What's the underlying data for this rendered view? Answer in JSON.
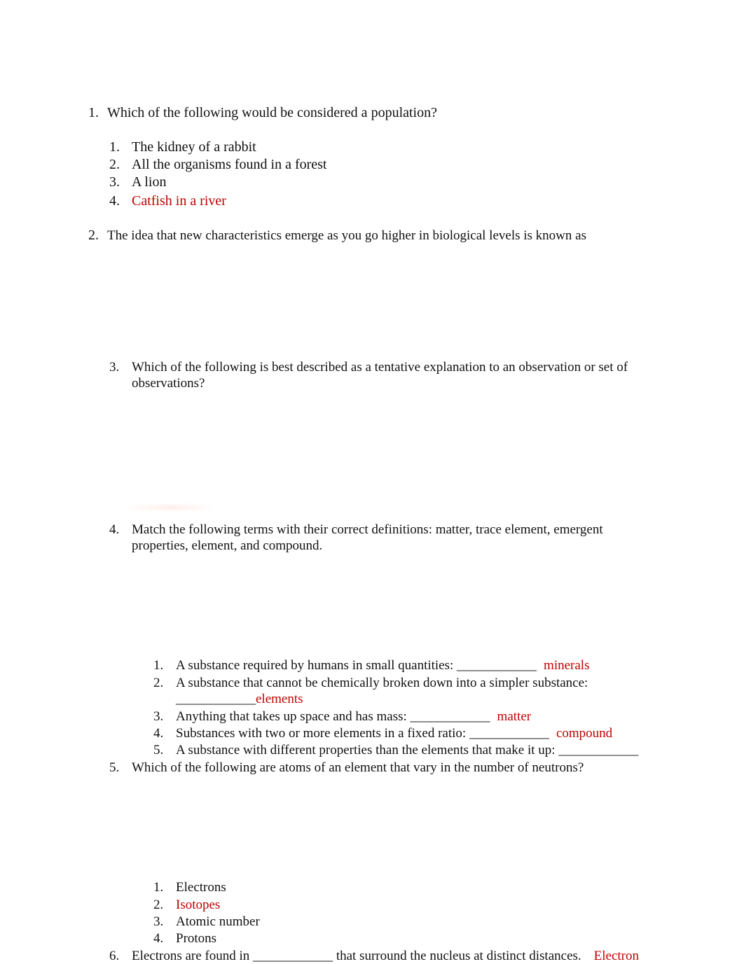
{
  "document": {
    "answer_color": "#c00000",
    "questions": [
      {
        "number": "1.",
        "text": "Which of the following would be considered a population?",
        "options": [
          {
            "number": "1.",
            "text": "The kidney of a rabbit",
            "is_answer": false
          },
          {
            "number": "2.",
            "text": "All the organisms found in a forest",
            "is_answer": false
          },
          {
            "number": "3.",
            "text": "A lion",
            "is_answer": false
          },
          {
            "number": "4.",
            "text": "Catfish in a river",
            "is_answer": true
          }
        ]
      },
      {
        "number": "2.",
        "text": "The idea that new characteristics emerge as you go higher in biological levels is known as"
      },
      {
        "number": "3.",
        "text_line1": "Which of the following is best described as a tentative explanation to an observation or set of",
        "text_line2": "observations?"
      },
      {
        "number": "4.",
        "text_line1": "Match the following terms with their correct definitions: matter, trace element, emergent",
        "text_line2": "properties, element, and compound.",
        "items": [
          {
            "number": "1.",
            "text": "A substance required by humans in small quantities: ",
            "blank": "____________",
            "answer": "minerals"
          },
          {
            "number": "2.",
            "text": "A substance that cannot be chemically broken down into a simpler substance:",
            "blank": "____________",
            "answer": "elements"
          },
          {
            "number": "3.",
            "text": "Anything that takes up space and has mass: ",
            "blank": "____________",
            "answer": "matter"
          },
          {
            "number": "4.",
            "text": "Substances with two or more elements in a fixed ratio: ",
            "blank": "____________",
            "answer": "compound"
          },
          {
            "number": "5.",
            "text": "A substance with different properties than the elements that make it up: ",
            "blank": "____________",
            "answer": ""
          }
        ]
      },
      {
        "number": "5.",
        "text": "Which of the following are atoms of an element that vary in the number of neutrons?",
        "options": [
          {
            "number": "1.",
            "text": "Electrons",
            "is_answer": false
          },
          {
            "number": "2.",
            "text": "Isotopes",
            "is_answer": true
          },
          {
            "number": "3.",
            "text": "Atomic number",
            "is_answer": false
          },
          {
            "number": "4.",
            "text": "Protons",
            "is_answer": false
          }
        ]
      },
      {
        "number": "6.",
        "text_before": "Electrons are found in ",
        "blank": "____________",
        "text_after": " that surround the nucleus at distinct distances.",
        "answer": "Electron"
      }
    ]
  }
}
